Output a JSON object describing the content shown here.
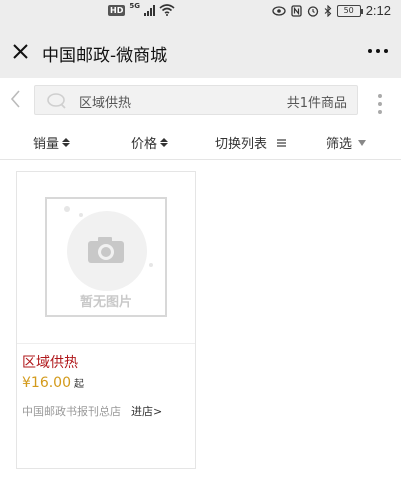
{
  "status_bar": {
    "hd": "HD",
    "network": "5G",
    "battery": "50",
    "time": "2:12"
  },
  "header": {
    "title": "中国邮政-微商城"
  },
  "search": {
    "query": "区域供热",
    "result_count": "共1件商品"
  },
  "sort_bar": {
    "sales": "销量",
    "price": "价格",
    "toggle_view": "切换列表",
    "filter": "筛选"
  },
  "products": [
    {
      "name": "区域供热",
      "price": "¥16.00",
      "price_suffix": "起",
      "shop": "中国邮政书报刊总店",
      "enter_shop": "进店>",
      "placeholder_text": "暂无图片"
    }
  ],
  "colors": {
    "product_name": "#b0181b",
    "price": "#d39a1b",
    "header_bg": "#ededed"
  }
}
